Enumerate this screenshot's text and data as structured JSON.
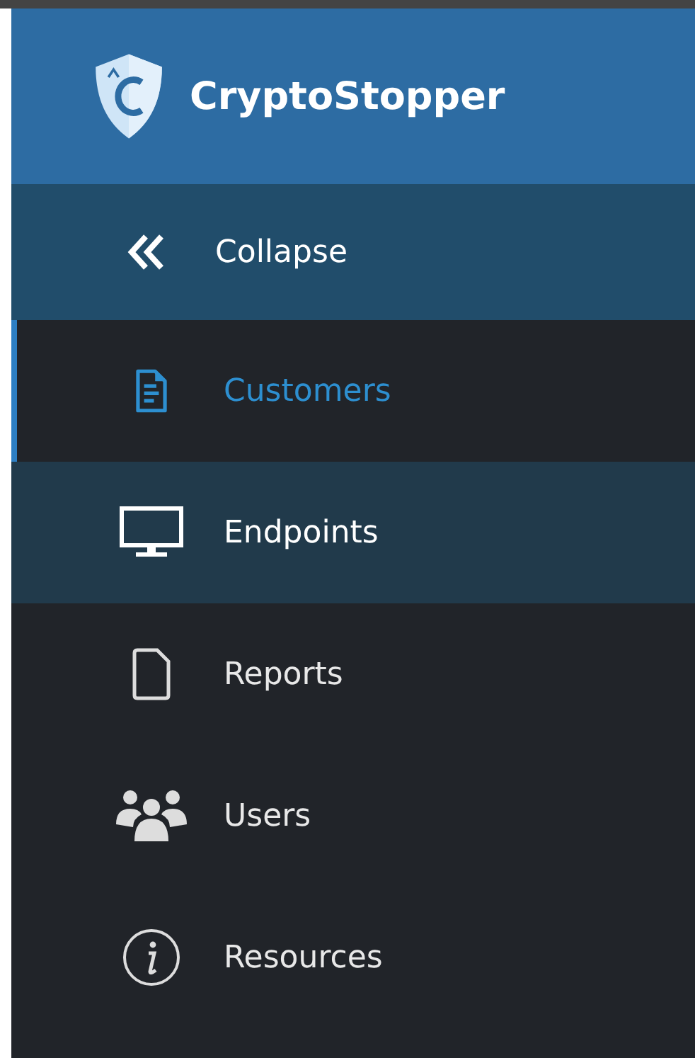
{
  "brand": {
    "name": "CryptoStopper"
  },
  "collapse": {
    "label": "Collapse"
  },
  "nav": [
    {
      "kind": "document",
      "label": "Customers",
      "selected": true,
      "highlighted": false
    },
    {
      "kind": "monitor",
      "label": "Endpoints",
      "selected": false,
      "highlighted": true
    },
    {
      "kind": "file",
      "label": "Reports",
      "selected": false,
      "highlighted": false
    },
    {
      "kind": "users",
      "label": "Users",
      "selected": false,
      "highlighted": false
    },
    {
      "kind": "info",
      "label": "Resources",
      "selected": false,
      "highlighted": false
    }
  ]
}
